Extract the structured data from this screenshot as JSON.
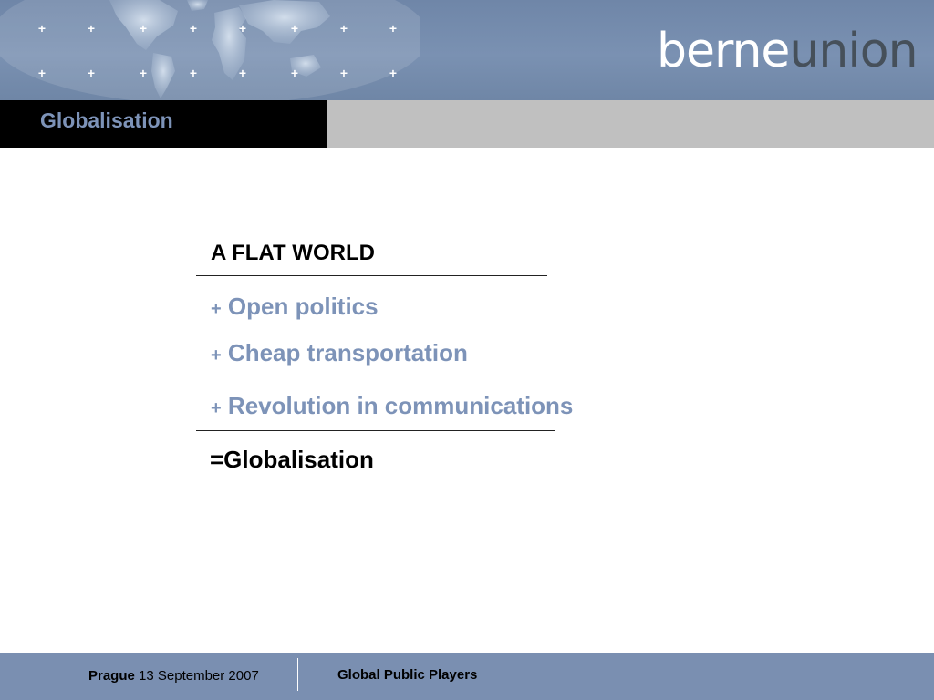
{
  "header": {
    "logo_left": "berne",
    "logo_right": "union",
    "section_title": "Globalisation",
    "plus_glyph": "+",
    "map_icon": "world-map-icon"
  },
  "slide": {
    "heading": "A FLAT WORLD",
    "bullets": [
      {
        "symbol": "+",
        "text": "Open politics"
      },
      {
        "symbol": "+",
        "text": "Cheap transportation"
      },
      {
        "symbol": "+",
        "text": "Revolution in communications"
      }
    ],
    "result": "=Globalisation"
  },
  "footer": {
    "city": "Prague",
    "date": "13 September 2007",
    "event": "Global Public Players"
  },
  "colors": {
    "header_blue": "#7a91b2",
    "accent_blue": "#7d93b8",
    "title_bar": "#000000",
    "title_bar_grey": "#c0c0c0",
    "footer_blue": "#7a8fb1",
    "logo_dark": "#46505a"
  }
}
